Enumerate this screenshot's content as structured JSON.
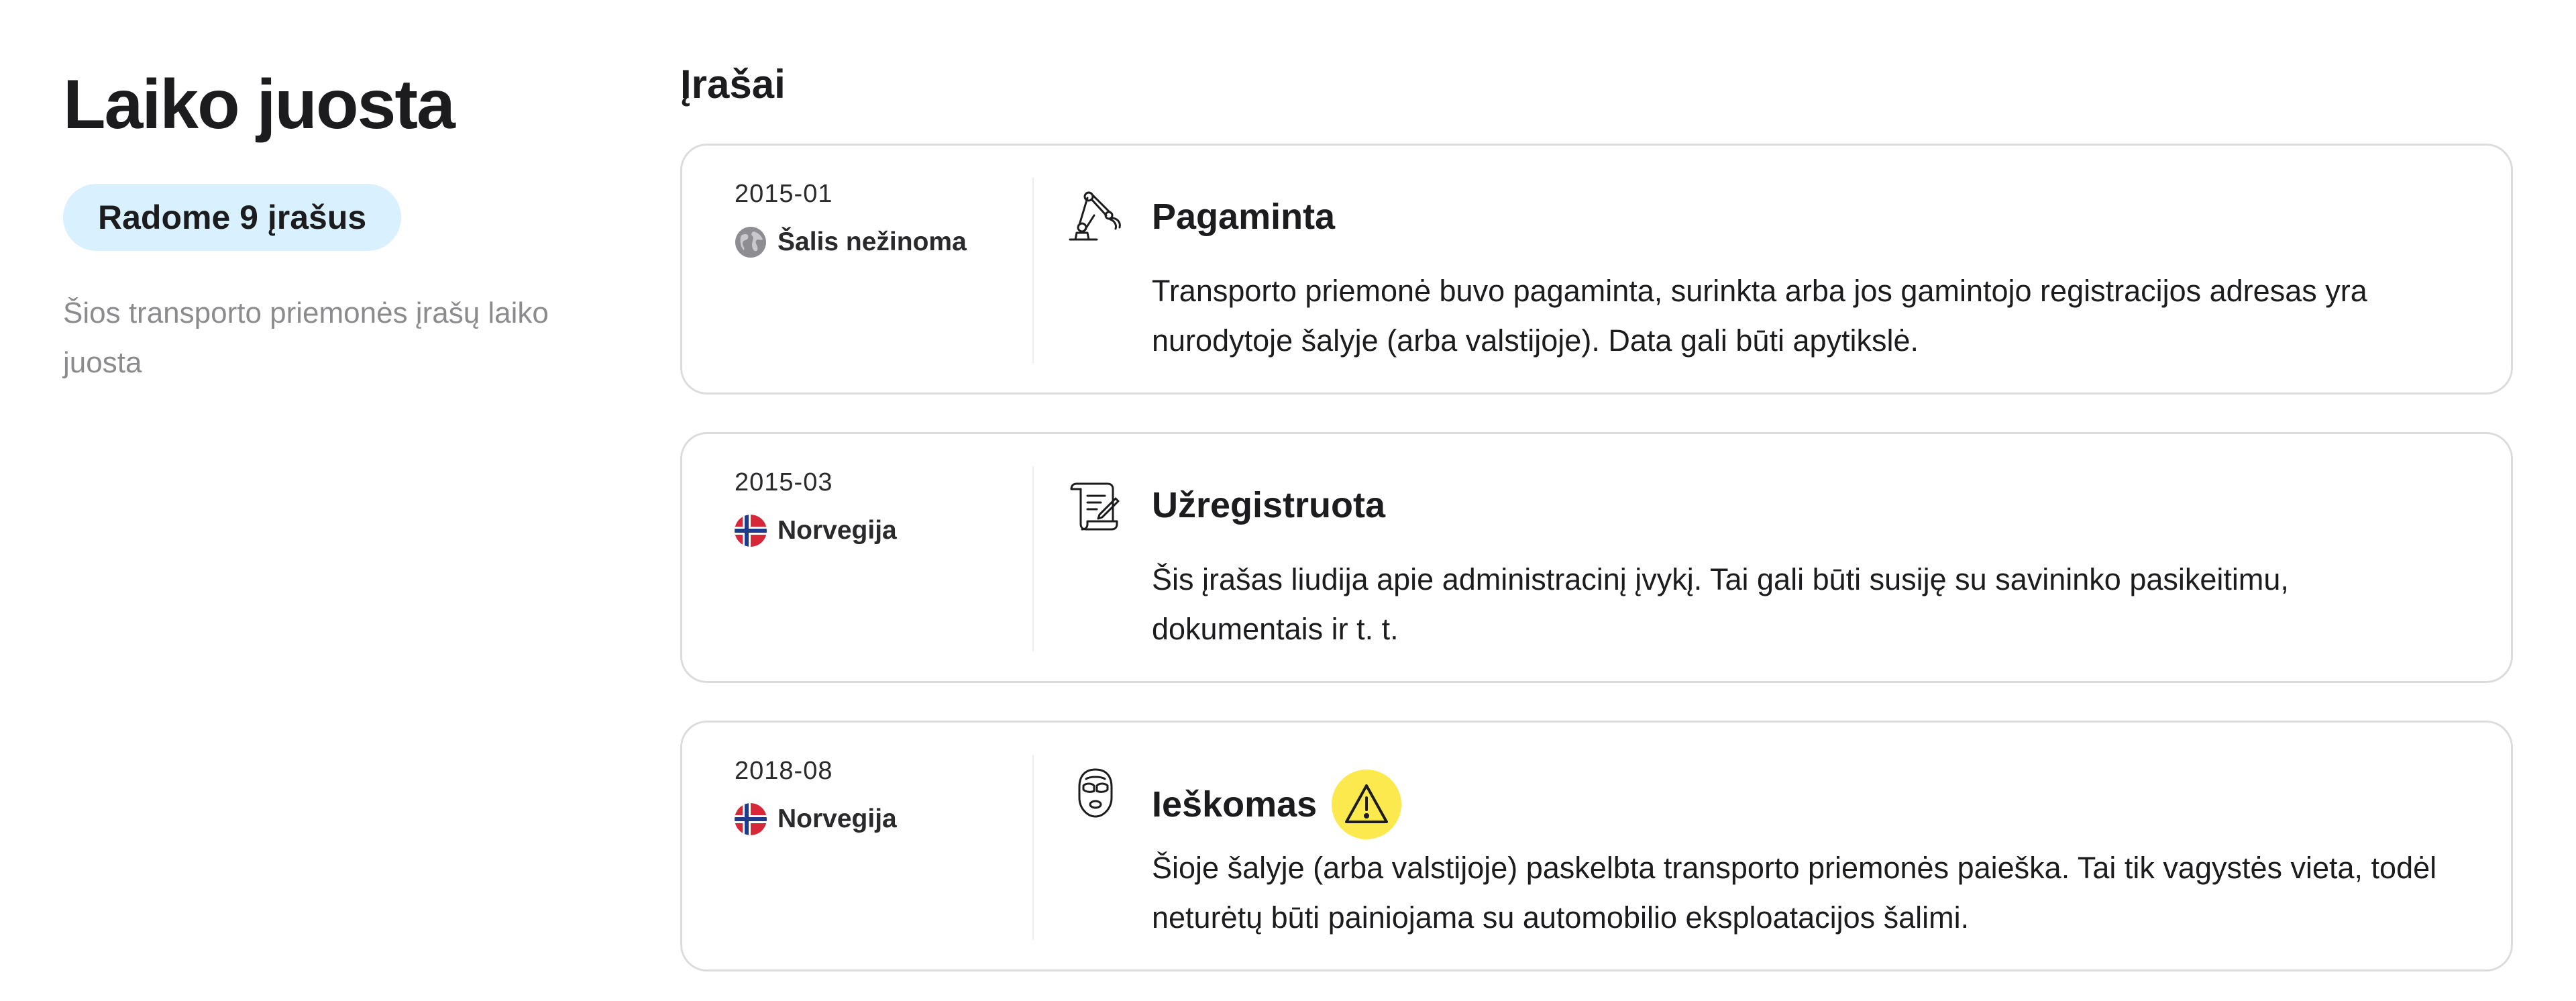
{
  "sidebar": {
    "title": "Laiko juosta",
    "count_badge": "Radome 9 įrašus",
    "subtitle": "Šios transporto priemonės įrašų laiko juosta"
  },
  "main": {
    "section_title": "Įrašai",
    "records": [
      {
        "date": "2015-01",
        "country": "Šalis nežinoma",
        "flag": "globe-icon",
        "icon": "robot-arm-icon",
        "title": "Pagaminta",
        "description": "Transporto priemonė buvo pagaminta, surinkta arba jos gamintojo registracijos adresas yra nurodytoje šalyje (arba valstijoje). Data gali būti apytikslė.",
        "warning": false
      },
      {
        "date": "2015-03",
        "country": "Norvegija",
        "flag": "norway-flag",
        "icon": "document-scroll-icon",
        "title": "Užregistruota",
        "description": "Šis įrašas liudija apie administracinį įvykį. Tai gali būti susiję su savininko pasikeitimu, dokumentais ir t. t.",
        "warning": false
      },
      {
        "date": "2018-08",
        "country": "Norvegija",
        "flag": "norway-flag",
        "icon": "thief-mask-icon",
        "title": "Ieškomas",
        "description": "Šioje šalyje (arba valstijoje) paskelbta transporto priemonės paieška. Tai tik vagystės vieta, todėl neturėtų būti painiojama su automobilio eksploatacijos šalimi.",
        "warning": true
      }
    ]
  },
  "colors": {
    "badge_bg": "#d9f0ff",
    "warning_bg": "#fbe94e",
    "card_border": "#dcdcdf",
    "muted_text": "#8b8b8e"
  }
}
